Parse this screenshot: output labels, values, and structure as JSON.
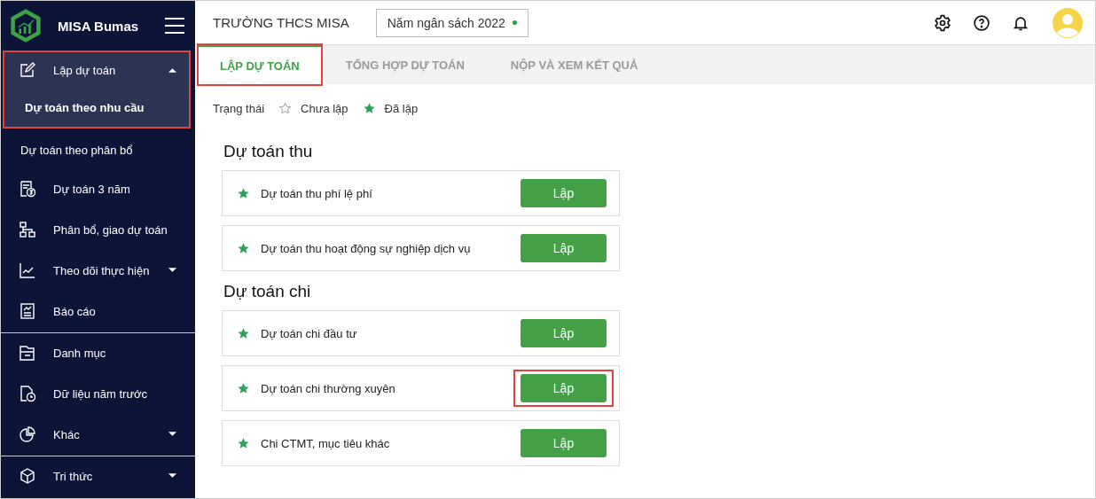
{
  "app": {
    "name": "MISA Bumas"
  },
  "sidebar": {
    "groups": [
      {
        "items": [
          {
            "label": "Lập dự toán",
            "expanded": true,
            "highlighted": true,
            "children": [
              {
                "label": "Dự toán theo nhu cầu",
                "selected": true
              },
              {
                "label": "Dự toán theo phân bổ",
                "selected": false
              }
            ]
          },
          {
            "label": "Dự toán 3 năm"
          },
          {
            "label": "Phân bổ, giao dự toán"
          },
          {
            "label": "Theo dõi thực hiện",
            "expanded": false
          },
          {
            "label": "Báo cáo"
          }
        ]
      },
      {
        "items": [
          {
            "label": "Danh mục"
          },
          {
            "label": "Dữ liệu năm trước"
          },
          {
            "label": "Khác",
            "expanded": false
          }
        ]
      },
      {
        "items": [
          {
            "label": "Tri thức",
            "expanded": false
          }
        ]
      }
    ]
  },
  "header": {
    "title": "TRƯỜNG THCS MISA",
    "year_selector": {
      "label": "Năm ngân sách 2022",
      "active": true
    }
  },
  "tabs": [
    {
      "label": "LẬP DỰ TOÁN",
      "selected": true,
      "highlighted": true
    },
    {
      "label": "TỔNG HỢP DỰ TOÁN",
      "selected": false,
      "highlighted": false
    },
    {
      "label": "NỘP VÀ XEM KẾT QUẢ",
      "selected": false,
      "highlighted": false
    }
  ],
  "legend": {
    "label": "Trạng thái",
    "items": [
      {
        "label": "Chưa lập",
        "done": false
      },
      {
        "label": "Đã lập",
        "done": true
      }
    ]
  },
  "sections": [
    {
      "title": "Dự toán thu",
      "rows": [
        {
          "label": "Dự toán thu phí lệ phí",
          "done": true,
          "button": "Lập",
          "highlighted": false
        },
        {
          "label": "Dự toán thu hoạt động sự nghiệp dịch vụ",
          "done": true,
          "button": "Lập",
          "highlighted": false
        }
      ]
    },
    {
      "title": "Dự toán chi",
      "rows": [
        {
          "label": "Dự toán chi đầu tư",
          "done": true,
          "button": "Lập",
          "highlighted": false
        },
        {
          "label": "Dự toán chi thường xuyên",
          "done": true,
          "button": "Lập",
          "highlighted": true
        },
        {
          "label": "Chi CTMT, mục tiêu khác",
          "done": true,
          "button": "Lập",
          "highlighted": false
        }
      ]
    }
  ]
}
